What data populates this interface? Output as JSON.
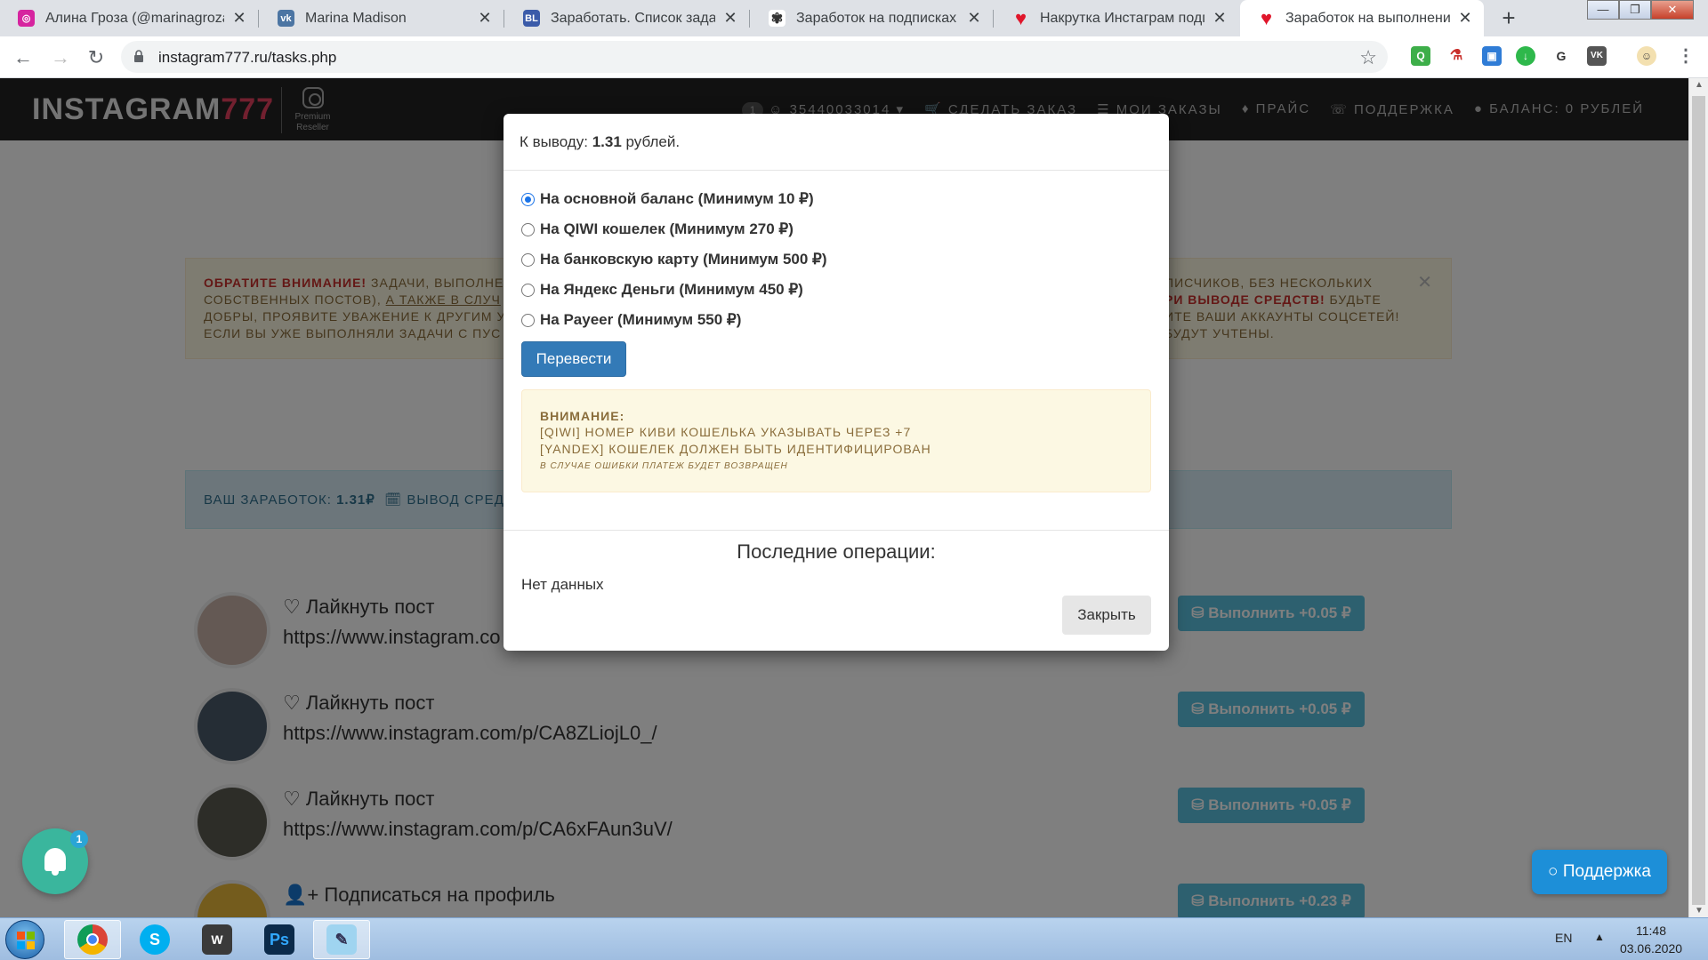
{
  "browser": {
    "tabs": [
      {
        "title": "Алина Гроза (@marinagroza",
        "icon": "instagram-icon",
        "color": "#d6249f"
      },
      {
        "title": "Marina Madison",
        "icon": "vk-icon",
        "color": "#4c75a3"
      },
      {
        "title": "Заработать. Список заданий",
        "icon": "bl-icon",
        "color": "#3b5ba9"
      },
      {
        "title": "Заработок на подписках и л",
        "icon": "octopus-icon",
        "color": "#333333"
      },
      {
        "title": "Накрутка Инстаграм подпис",
        "icon": "heart-icon",
        "color": "#e0162b"
      },
      {
        "title": "Заработок на выполнении з",
        "icon": "heart-icon",
        "color": "#e0162b"
      }
    ],
    "url": "instagram777.ru/tasks.php"
  },
  "site": {
    "logo_text": "INSTAGRAM",
    "logo_num": "777",
    "logo_sub": "Premium Reseller",
    "nav": {
      "badge": "1",
      "account": "35440033014",
      "order": "СДЕЛАТЬ ЗАКАЗ",
      "orders": "МОИ ЗАКАЗЫ",
      "price": "ПРАЙС",
      "support": "ПОДДЕРЖКА",
      "balance": "БАЛАНС: 0 РУБЛЕЙ"
    },
    "notice": {
      "label": "ОБРАТИТЕ ВНИМАНИЕ!",
      "line1a": "ЗАДАЧИ, ВЫПОЛНЕ",
      "line1b": "ПИСЧИКОВ, БЕЗ НЕСКОЛЬКИХ",
      "line2a": "СОБСТВЕННЫХ ПОСТОВ),",
      "line2link": "А ТАКЖЕ В СЛУЧ",
      "line2red": "РИ ВЫВОДЕ СРЕДСТВ!",
      "line2b": "БУДЬТЕ",
      "line3a": "ДОБРЫ, ПРОЯВИТЕ УВАЖЕНИЕ К ДРУГИМ У",
      "line3b": "ИТЕ ВАШИ АККАУНТЫ СОЦСЕТЕЙ!",
      "line4a": "ЕСЛИ ВЫ УЖЕ ВЫПОЛНЯЛИ ЗАДАЧИ С ПУС",
      "line4b": "БУДУТ УЧТЕНЫ."
    },
    "earn": {
      "label": "ВАШ ЗАРАБОТОК:",
      "value": "1.31₽",
      "withdraw": "ВЫВОД СРЕДС"
    },
    "tasks": [
      {
        "action": "Лайкнуть пост",
        "link": "https://www.instagram.co",
        "reward": "Выполнить +0.05 ₽",
        "icon": "heart-outline-icon"
      },
      {
        "action": "Лайкнуть пост",
        "link": "https://www.instagram.com/p/CA8ZLiojL0_/",
        "reward": "Выполнить +0.05 ₽",
        "icon": "heart-outline-icon"
      },
      {
        "action": "Лайкнуть пост",
        "link": "https://www.instagram.com/p/CA6xFAun3uV/",
        "reward": "Выполнить +0.05 ₽",
        "icon": "heart-outline-icon"
      },
      {
        "action": "Подписаться на профиль",
        "link": "",
        "reward": "Выполнить +0.23 ₽",
        "icon": "user-plus-icon"
      }
    ],
    "notif_count": "1",
    "support_btn": "Поддержка"
  },
  "modal": {
    "to_withdraw_label": "К выводу:",
    "amount": "1.31",
    "amount_unit": "рублей.",
    "options": [
      {
        "label": "На основной баланс (Минимум 10 ₽)",
        "selected": true
      },
      {
        "label": "На QIWI кошелек (Минимум 270 ₽)",
        "selected": false
      },
      {
        "label": "На банковскую карту (Минимум 500 ₽)",
        "selected": false
      },
      {
        "label": "На Яндекс Деньги (Минимум 450 ₽)",
        "selected": false
      },
      {
        "label": "На Payeer (Минимум 550 ₽)",
        "selected": false
      }
    ],
    "transfer_btn": "Перевести",
    "warning": {
      "title": "ВНИМАНИЕ:",
      "line1": "[QIWI] НОМЕР КИВИ КОШЕЛЬКА УКАЗЫВАТЬ ЧЕРЕЗ +7",
      "line2": "[YANDEX] КОШЕЛЕК ДОЛЖЕН БЫТЬ ИДЕНТИФИЦИРОВАН",
      "small": "В СЛУЧАЕ ОШИБКИ ПЛАТЕЖ БУДЕТ ВОЗВРАЩЕН"
    },
    "ops_title": "Последние операции:",
    "no_data": "Нет данных",
    "close_btn": "Закрыть"
  },
  "taskbar": {
    "lang": "EN",
    "time": "11:48",
    "date": "03.06.2020"
  }
}
